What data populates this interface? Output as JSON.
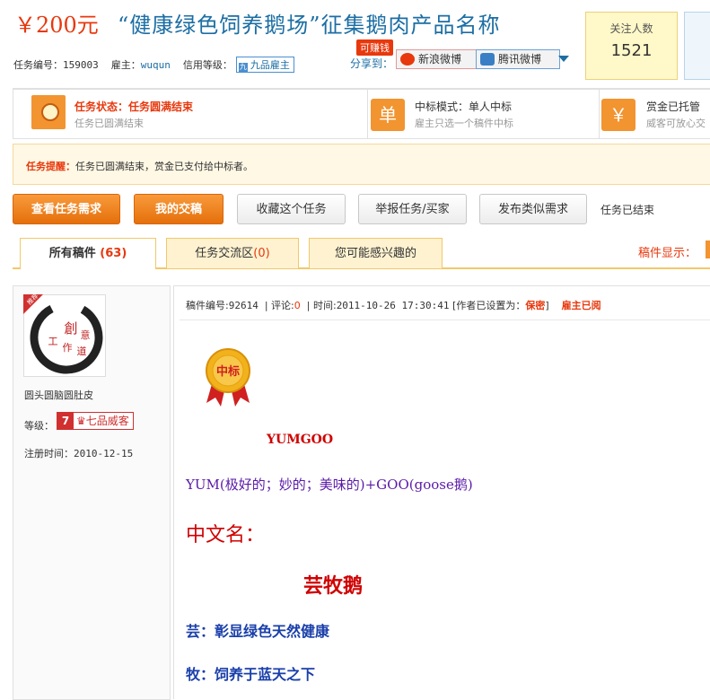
{
  "header": {
    "price": "￥200元",
    "title": "“健康绿色饲养鹅场”征集鹅肉产品名称",
    "task_no_label": "任务编号：",
    "task_no": "159003",
    "employer_label": "雇主：",
    "employer": "wuqun",
    "credit_label": "信用等级：",
    "credit_level": "九品雇主",
    "earn_badge": "可赚钱",
    "share_label": "分享到：",
    "share_weibo": "新浪微博",
    "share_tencent": "腾讯微博",
    "follow_label": "关注人数",
    "follow_count": "1521"
  },
  "status": {
    "state_label": "任务状态：",
    "state_value": "任务圆满结束",
    "state_sub": "任务已圆满结束",
    "mode_icon": "单",
    "mode_label": "中标模式：",
    "mode_value": "单人中标",
    "mode_sub": "雇主只选一个稿件中标",
    "bounty_icon": "￥",
    "bounty_label": "赏金已托管",
    "bounty_sub": "威客可放心交"
  },
  "reminder": {
    "label": "任务提醒：",
    "text": "任务已圆满结束，赏金已支付给中标者。"
  },
  "actions": {
    "view_requirements": "查看任务需求",
    "my_submission": "我的交稿",
    "bookmark": "收藏这个任务",
    "report": "举报任务/买家",
    "post_similar": "发布类似需求",
    "ended": "任务已结束"
  },
  "tabs": {
    "all_label": "所有稿件",
    "all_count": "(63)",
    "forum_label": "任务交流区",
    "forum_count": "(0)",
    "interest_label": "您可能感兴趣的",
    "display_label": "稿件显示："
  },
  "user": {
    "recommend": "推荐",
    "avatar_chars": "创意有道工作室",
    "name": "圆头圆脑圆肚皮",
    "level_label": "等级：",
    "level_num": "7",
    "level_name": "七品威客",
    "reg_label": "注册时间：",
    "reg_date": "2010-12-15"
  },
  "entry": {
    "no_label": "稿件编号:",
    "no": "92614",
    "comment_label": "评论:",
    "comment_count": "0",
    "time_label": "时间:",
    "time": "2011-10-26 17:30:41",
    "author_setting": "[作者已设置为：",
    "secret": "保密",
    "close_bracket": "]",
    "read_status": "雇主已阅",
    "win_badge": "中标",
    "lines": [
      "YUMGOO",
      "YUM(极好的；妙的；美味的)+GOO(goose鹅)",
      "中文名：",
      "芸牧鹅",
      "芸：彰显绿色天然健康",
      "牧：饲养于蓝天之下"
    ]
  },
  "colors": {
    "accent_orange": "#f29430",
    "price_red": "#e8380d",
    "title_blue": "#1c6ea4"
  }
}
